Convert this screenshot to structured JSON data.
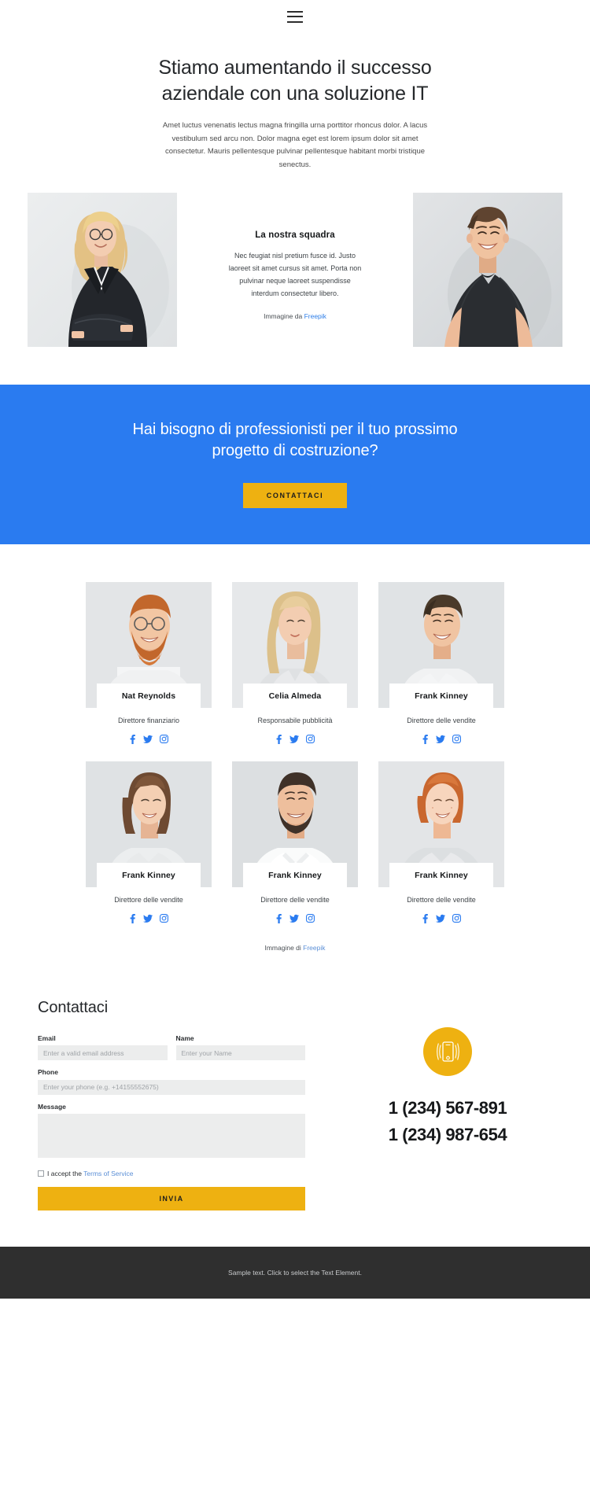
{
  "header": {
    "menu_icon": "hamburger-menu-icon"
  },
  "hero": {
    "title": "Stiamo aumentando il successo aziendale con una soluzione IT",
    "subtitle": "Amet luctus venenatis lectus magna fringilla urna porttitor rhoncus dolor. A lacus vestibulum sed arcu non. Dolor magna eget est lorem ipsum dolor sit amet consectetur. Mauris pellentesque pulvinar pellentesque habitant morbi tristique senectus."
  },
  "intro": {
    "heading": "La nostra squadra",
    "body": "Nec feugiat nisl pretium fusce id. Justo laoreet sit amet cursus sit amet. Porta non pulvinar neque laoreet suspendisse interdum consectetur libero.",
    "credit_prefix": "Immagine da ",
    "credit_link": "Freepik",
    "left_photo_alt": "businesswoman-portrait",
    "right_photo_alt": "young-man-portrait"
  },
  "cta": {
    "title": "Hai bisogno di professionisti per il tuo prossimo progetto di costruzione?",
    "button_label": "CONTATTACI",
    "background_color": "#2a7bf0",
    "button_color": "#eeb111"
  },
  "team": {
    "rows": [
      [
        {
          "name": "Nat Reynolds",
          "role": "Direttore finanziario"
        },
        {
          "name": "Celia Almeda",
          "role": "Responsabile pubblicità"
        },
        {
          "name": "Frank Kinney",
          "role": "Direttore delle vendite"
        }
      ],
      [
        {
          "name": "Frank Kinney",
          "role": "Direttore delle vendite"
        },
        {
          "name": "Frank Kinney",
          "role": "Direttore delle vendite"
        },
        {
          "name": "Frank Kinney",
          "role": "Direttore delle vendite"
        }
      ]
    ],
    "social_icons": [
      "facebook-icon",
      "twitter-icon",
      "instagram-icon"
    ],
    "credit_prefix": "Immagine di ",
    "credit_link": "Freepik"
  },
  "contact": {
    "title": "Contattaci",
    "fields": {
      "email_label": "Email",
      "email_placeholder": "Enter a valid email address",
      "name_label": "Name",
      "name_placeholder": "Enter your Name",
      "phone_label": "Phone",
      "phone_placeholder": "Enter your phone (e.g. +14155552675)",
      "message_label": "Message",
      "message_placeholder": ""
    },
    "terms_prefix": "I accept the ",
    "terms_link": "Terms of Service",
    "submit_label": "INVIA",
    "phone_icon": "mobile-phone-ringing-icon",
    "phone_numbers": [
      "1 (234) 567-891",
      "1 (234) 987-654"
    ]
  },
  "footer": {
    "text": "Sample text. Click to select the Text Element."
  }
}
